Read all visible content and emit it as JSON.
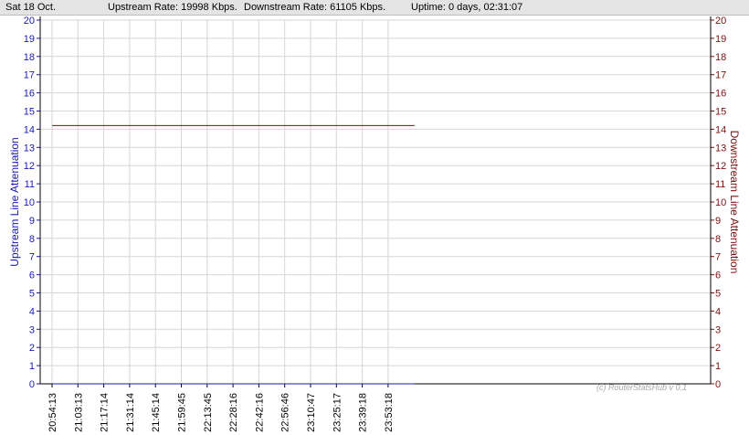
{
  "header": {
    "date": "Sat 18 Oct.",
    "upstream_rate": "Upstream Rate: 19998 Kbps.",
    "downstream_rate": "Downstream Rate: 61105 Kbps.",
    "uptime": "Uptime: 0 days, 02:31:07"
  },
  "watermark": "(c) RouterStatsHub v 0.1",
  "colors": {
    "upstream": "#1a1ab0",
    "downstream": "#7a1010",
    "grid": "#d6d6d6",
    "axis": "#000000"
  },
  "chart_data": {
    "type": "line",
    "ylabel_left": "Upstream Line Attenuation",
    "ylabel_right": "Downstream Line Attenuation",
    "ylim": [
      0,
      20
    ],
    "yticks": [
      0,
      1,
      2,
      3,
      4,
      5,
      6,
      7,
      8,
      9,
      10,
      11,
      12,
      13,
      14,
      15,
      16,
      17,
      18,
      19,
      20
    ],
    "grid": true,
    "x": [
      "20:54:13",
      "21:03:13",
      "21:17:14",
      "21:31:14",
      "21:45:14",
      "21:59:45",
      "22:13:45",
      "22:28:16",
      "22:42:16",
      "22:56:46",
      "23:10:47",
      "23:25:17",
      "23:39:18",
      "23:53:18"
    ],
    "series": [
      {
        "name": "Upstream Line Attenuation",
        "axis": "left",
        "color": "#1a1ab0",
        "values": [
          0,
          0,
          0,
          0,
          0,
          0,
          0,
          0,
          0,
          0,
          0,
          0,
          0,
          0
        ]
      },
      {
        "name": "Downstream Line Attenuation",
        "axis": "right",
        "color": "#7a1010",
        "values": [
          14.2,
          14.2,
          14.2,
          14.2,
          14.2,
          14.2,
          14.2,
          14.2,
          14.2,
          14.2,
          14.2,
          14.2,
          14.2,
          14.2
        ]
      }
    ]
  }
}
